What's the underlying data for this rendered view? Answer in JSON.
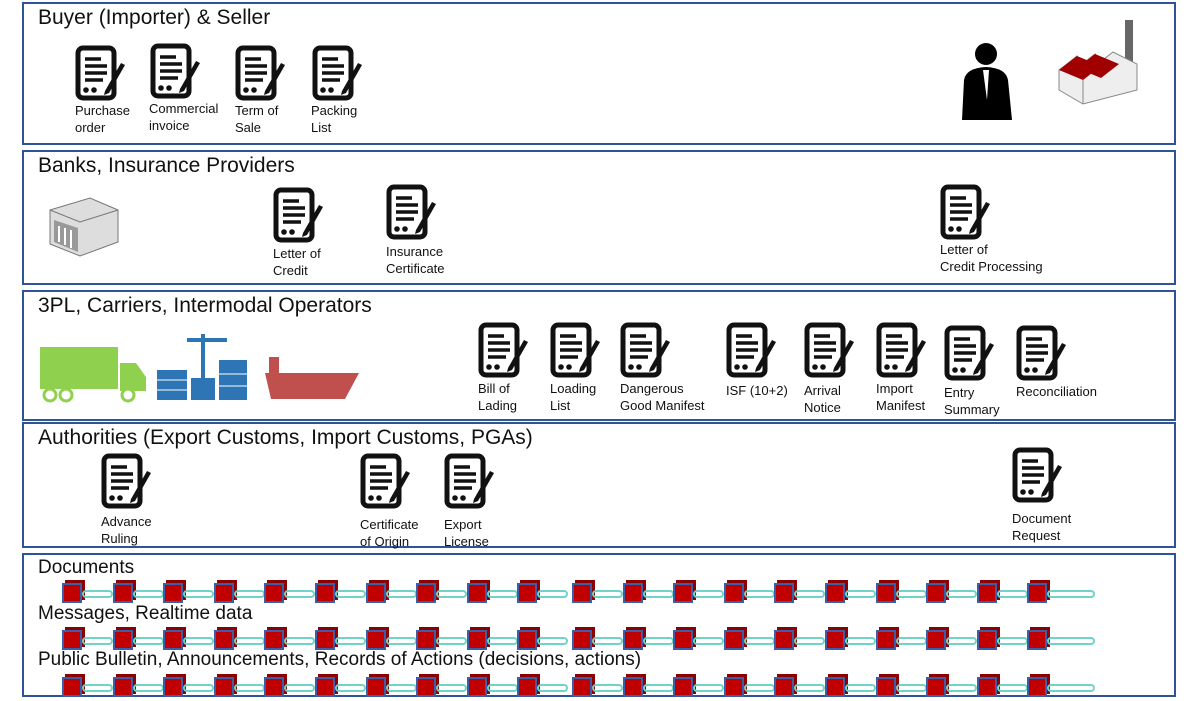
{
  "sections": [
    {
      "title": "Buyer (Importer) & Seller",
      "docs": [
        {
          "label": [
            "Purchase",
            "order"
          ]
        },
        {
          "label": [
            "Commercial",
            "invoice"
          ]
        },
        {
          "label": [
            "Term of",
            "Sale"
          ]
        },
        {
          "label": [
            "Packing",
            "List"
          ]
        }
      ],
      "images": [
        "person-silhouette-icon",
        "factory-icon"
      ]
    },
    {
      "title": "Banks, Insurance Providers",
      "docs": [
        {
          "label": [
            "Letter of",
            "Credit"
          ]
        },
        {
          "label": [
            "Insurance",
            "Certificate"
          ]
        },
        {
          "label": [
            "Letter of",
            "Credit Processing"
          ]
        }
      ],
      "images": [
        "bank-building-icon"
      ]
    },
    {
      "title": "3PL, Carriers, Intermodal Operators",
      "docs": [
        {
          "label": [
            "Bill of",
            "Lading"
          ]
        },
        {
          "label": [
            "Loading",
            "List"
          ]
        },
        {
          "label": [
            "Dangerous",
            "Good Manifest"
          ]
        },
        {
          "label": [
            "ISF (10+2)"
          ]
        },
        {
          "label": [
            "Arrival",
            "Notice"
          ]
        },
        {
          "label": [
            "Import",
            "Manifest"
          ]
        },
        {
          "label": [
            "Entry",
            "Summary"
          ]
        },
        {
          "label": [
            "Reconciliation"
          ]
        }
      ],
      "images": [
        "truck-icon",
        "port-crane-icon",
        "ship-icon"
      ]
    },
    {
      "title": "Authorities (Export Customs, Import Customs, PGAs)",
      "docs": [
        {
          "label": [
            "Advance",
            "Ruling"
          ]
        },
        {
          "label": [
            "Certificate",
            "of Origin"
          ]
        },
        {
          "label": [
            "Export",
            "License"
          ]
        },
        {
          "label": [
            "Document",
            "Request"
          ]
        }
      ]
    }
  ],
  "ledgers": [
    {
      "title": "Documents",
      "blocks": 20
    },
    {
      "title": "Messages, Realtime data",
      "blocks": 20
    },
    {
      "title": "Public Bulletin, Announcements, Records of Actions (decisions, actions)",
      "blocks": 20
    }
  ],
  "colors": {
    "border": "#2f5496",
    "block": "#c00000",
    "chain": "#6fd3c8",
    "truck": "#8fd14f",
    "port": "#2e75b6",
    "ship": "#c0504d"
  }
}
